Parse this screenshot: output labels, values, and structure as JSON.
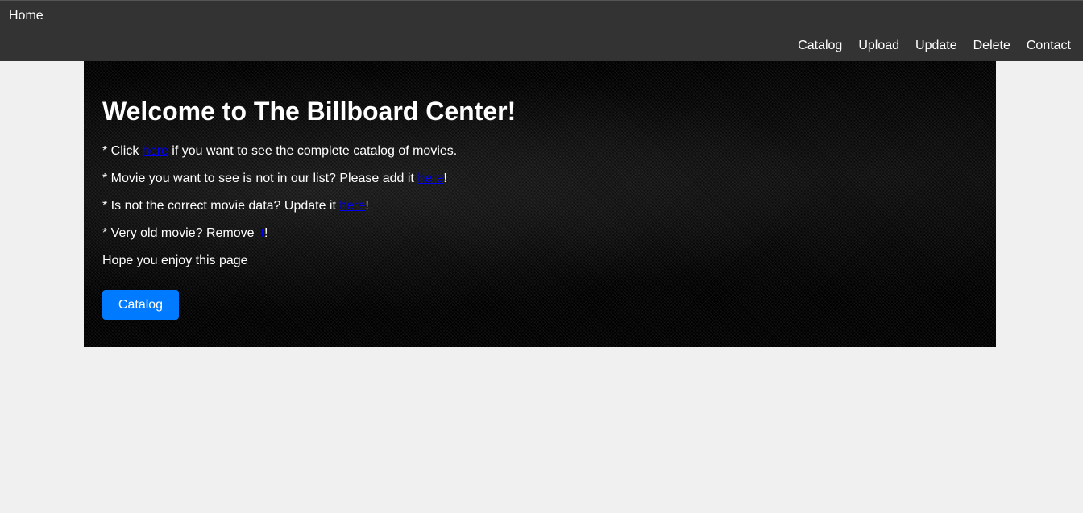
{
  "navbar": {
    "home_label": "Home",
    "links": [
      {
        "label": "Catalog"
      },
      {
        "label": "Upload"
      },
      {
        "label": "Update"
      },
      {
        "label": "Delete"
      },
      {
        "label": "Contact"
      }
    ]
  },
  "hero": {
    "title": "Welcome to The Billboard Center!",
    "line1": {
      "prefix": "* Click ",
      "link": "here",
      "suffix": " if you want to see the complete catalog of movies."
    },
    "line2": {
      "prefix": "* Movie you want to see is not in our list? Please add it ",
      "link": "here",
      "suffix": "!"
    },
    "line3": {
      "prefix": "* Is not the correct movie data? Update it ",
      "link": "here",
      "suffix": "!"
    },
    "line4": {
      "prefix": "* Very old movie? Remove ",
      "link": "it",
      "suffix": "!"
    },
    "line5": "Hope you enjoy this page",
    "button_label": "Catalog"
  },
  "colors": {
    "navbar_bg": "#333333",
    "page_bg": "#f0f0f0",
    "button_bg": "#007bff",
    "link": "#0000ee"
  }
}
